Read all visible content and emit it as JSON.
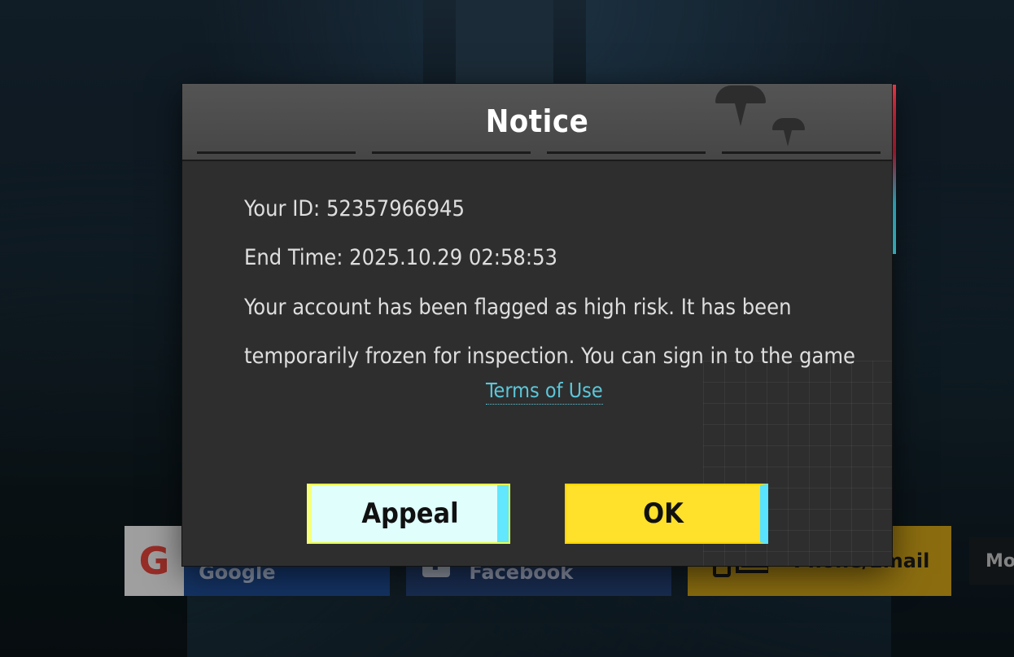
{
  "dialog": {
    "title": "Notice",
    "id_line": "Your ID: 52357966945",
    "end_time_line": "End Time: 2025.10.29 02:58:53",
    "message_line1": "Your account has been flagged as high risk. It has been",
    "message_line2": "temporarily frozen for inspection. You can sign in to the game",
    "terms_link": "Terms of Use",
    "appeal_button": "Appeal",
    "ok_button": "OK"
  },
  "login_bar": {
    "google_label": "Sign in with Google",
    "facebook_label": "Login with Facebook",
    "phone_label": "Phone/Email",
    "more_label": "Mor"
  },
  "colors": {
    "dialog_bg": "#2e2e2e",
    "header_bg": "#4e4e4e",
    "link": "#5cc6d8",
    "appeal_bg": "#dffefc",
    "ok_bg": "#ffe02a"
  },
  "icons": [
    "google-icon",
    "facebook-icon",
    "phone-email-icon",
    "parachute-icon"
  ]
}
